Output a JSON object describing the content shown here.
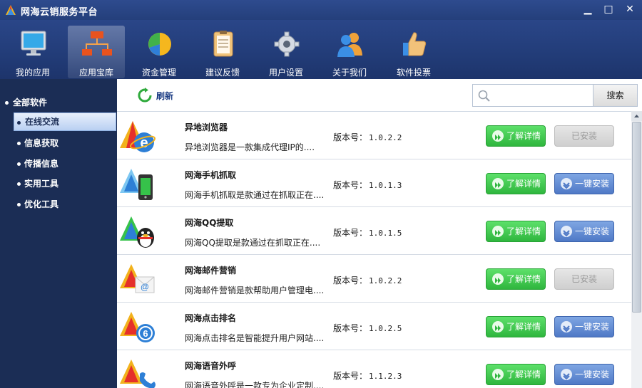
{
  "window": {
    "title": "网海云销服务平台",
    "min": "▁",
    "max": "□",
    "close": "✕"
  },
  "toolbar": [
    {
      "label": "我的应用",
      "icon": "monitor-icon"
    },
    {
      "label": "应用宝库",
      "icon": "network-icon"
    },
    {
      "label": "资金管理",
      "icon": "pie-chart-icon"
    },
    {
      "label": "建议反馈",
      "icon": "clipboard-icon"
    },
    {
      "label": "用户设置",
      "icon": "gear-icon"
    },
    {
      "label": "关于我们",
      "icon": "users-icon"
    },
    {
      "label": "软件投票",
      "icon": "thumbs-up-icon"
    }
  ],
  "sidebar": {
    "root": "全部软件",
    "items": [
      {
        "label": "在线交流",
        "selected": true
      },
      {
        "label": "信息获取",
        "selected": false
      },
      {
        "label": "传播信息",
        "selected": false
      },
      {
        "label": "实用工具",
        "selected": false
      },
      {
        "label": "优化工具",
        "selected": false
      }
    ]
  },
  "main": {
    "refresh_label": "刷新",
    "search": {
      "value": "",
      "placeholder": "",
      "button": "搜索"
    },
    "version_label": "版本号：",
    "detail_label": "了解详情",
    "install_label": "一键安装",
    "installed_label": "已安装",
    "apps": [
      {
        "name": "异地浏览器",
        "desc": "异地浏览器是一款集成代理IP的....",
        "version": "1.0.2.2",
        "installed": true,
        "icon": "browser-e-icon"
      },
      {
        "name": "网海手机抓取",
        "desc": "网海手机抓取是款通过在抓取正在....",
        "version": "1.0.1.3",
        "installed": false,
        "icon": "phone-icon"
      },
      {
        "name": "网海QQ提取",
        "desc": "网海QQ提取是款通过在抓取正在....",
        "version": "1.0.1.5",
        "installed": false,
        "icon": "qq-penguin-icon"
      },
      {
        "name": "网海邮件营销",
        "desc": "网海邮件营销是款帮助用户管理电....",
        "version": "1.0.2.2",
        "installed": true,
        "icon": "email-icon"
      },
      {
        "name": "网海点击排名",
        "desc": "网海点击排名是智能提升用户网站....",
        "version": "1.0.2.5",
        "installed": false,
        "icon": "click-rank-icon"
      },
      {
        "name": "网海语音外呼",
        "desc": "网海语音外呼是一款专为企业定制....",
        "version": "1.1.2.3",
        "installed": false,
        "icon": "voice-call-icon"
      }
    ]
  },
  "colors": {
    "titlebar": "#2e4b8e",
    "sidebar": "#1b2d55",
    "green_button": "#3cc24a",
    "blue_button": "#5a83cc",
    "installed_button": "#d9d9d9"
  }
}
